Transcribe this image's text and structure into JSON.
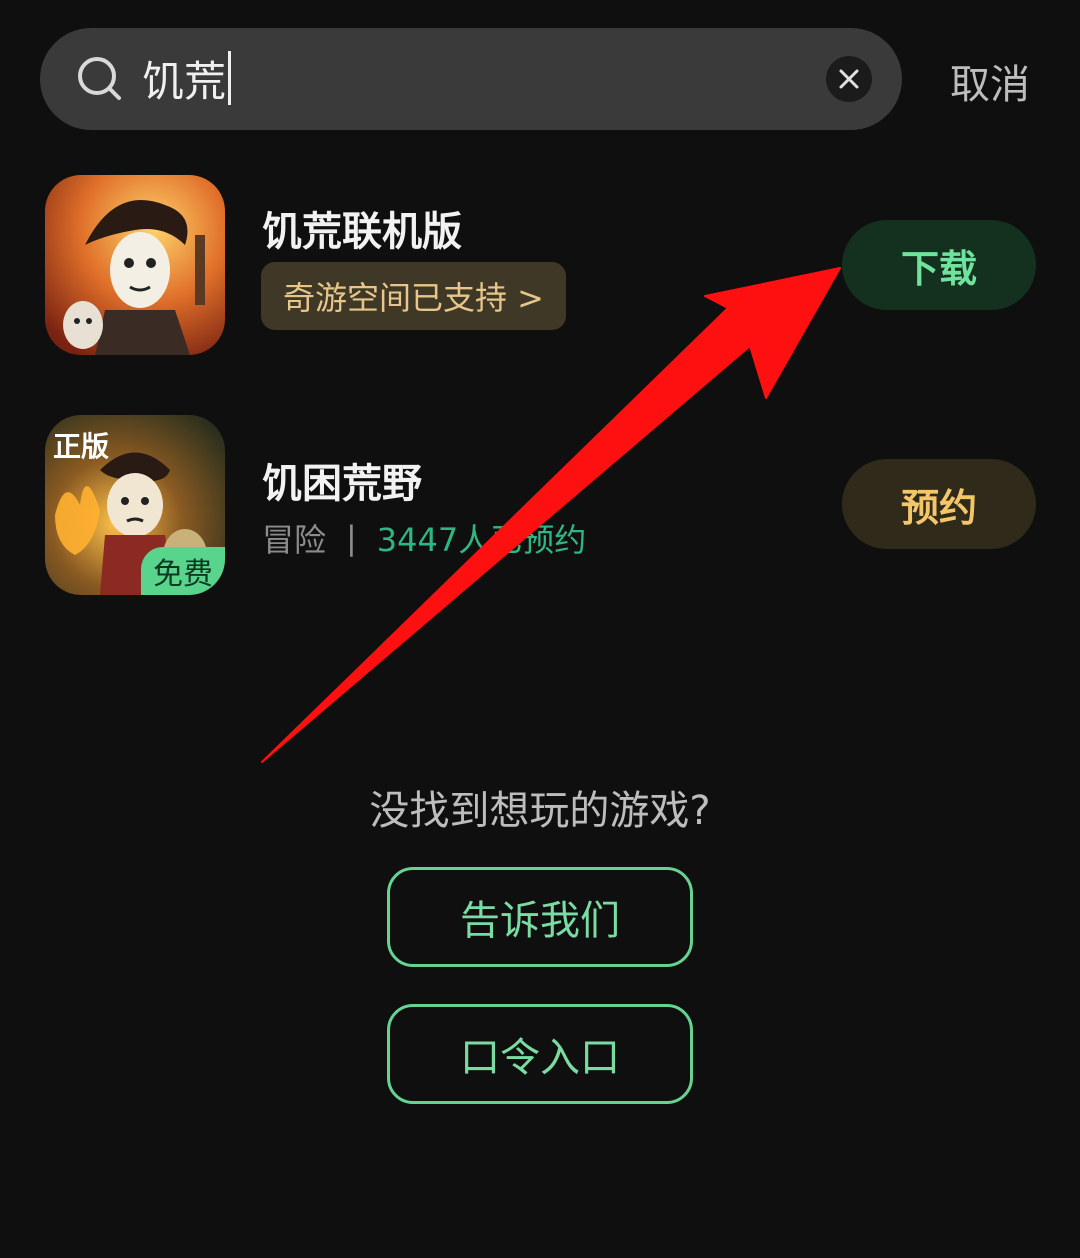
{
  "search": {
    "query": "饥荒",
    "cancel_label": "取消"
  },
  "results": [
    {
      "title": "饥荒联机版",
      "support_tag": "奇游空间已支持 >",
      "action_label": "下载"
    },
    {
      "title": "饥困荒野",
      "official_badge": "正版",
      "free_badge": "免费",
      "genre": "冒险",
      "separator": "|",
      "count_text": "3447人已预约",
      "action_label": "预约"
    }
  ],
  "not_found": {
    "prompt": "没找到想玩的游戏?",
    "tell_us_label": "告诉我们",
    "code_entry_label": "口令入口"
  },
  "colors": {
    "accent_green": "#6fe29b",
    "accent_gold": "#f3c66a",
    "annotation_arrow": "#ff1010"
  }
}
